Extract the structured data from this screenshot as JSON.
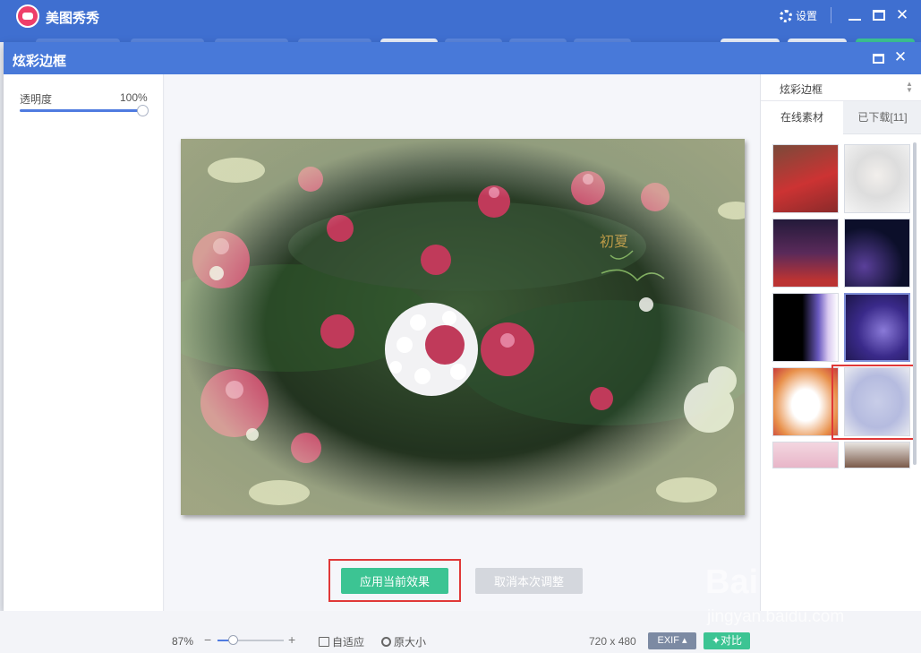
{
  "app": {
    "name": "美图秀秀",
    "settings_label": "设置"
  },
  "dialog": {
    "title": "炫彩边框",
    "opacity_label": "透明度",
    "opacity_value": "100%",
    "opacity_level": 1.0,
    "apply_label": "应用当前效果",
    "cancel_label": "取消本次调整"
  },
  "right_panel": {
    "category": "炫彩边框",
    "tab_online": "在线素材",
    "tab_downloaded": "已下载[11]"
  },
  "statusbar": {
    "zoom": "87%",
    "fit_label": "自适应",
    "actual_label": "原大小",
    "dimensions": "720 x 480",
    "exif_label": "EXIF ▴",
    "compare_label": "对比"
  },
  "watermark": {
    "text": "Bai 经验",
    "sub": "jingyan.baidu.com"
  },
  "colors": {
    "title_bar": "#3f6fd0",
    "dialog_title": "#4879d9",
    "accent_green": "#3cc493",
    "highlight_red": "#e03838"
  }
}
